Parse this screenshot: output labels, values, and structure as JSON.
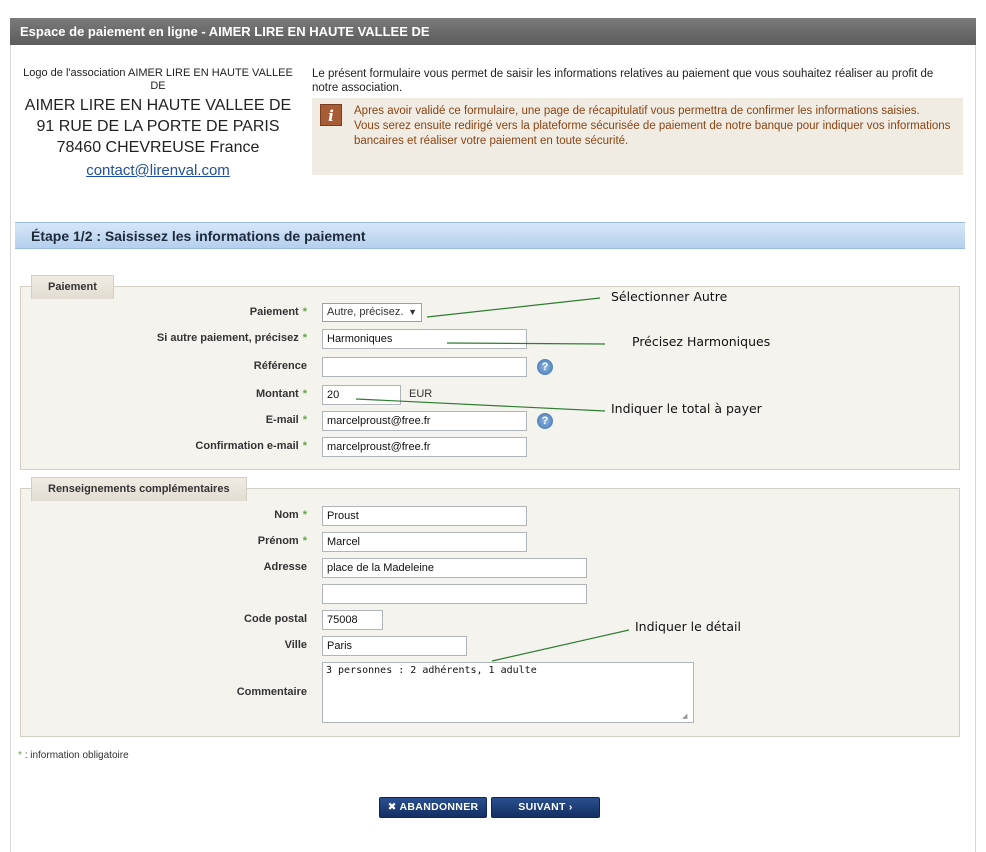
{
  "header": {
    "title": "Espace de paiement en ligne - AIMER LIRE EN HAUTE VALLEE DE"
  },
  "association": {
    "logo_alt": "Logo de l'association AIMER LIRE EN HAUTE VALLEE DE",
    "name": "AIMER LIRE EN HAUTE VALLEE DE",
    "address": "91 RUE DE LA PORTE DE PARIS",
    "city": "78460 CHEVREUSE France",
    "email": "contact@lirenval.com"
  },
  "intro": {
    "text": "Le présent formulaire vous permet de saisir les informations relatives au paiement que vous souhaitez réaliser au profit de notre association.",
    "info_line1": "Apres avoir validé ce formulaire, une page de récapitulatif vous permettra de confirmer les informations saisies.",
    "info_line2": "Vous serez ensuite redirigé vers la plateforme sécurisée de paiement de notre banque pour indiquer vos informations bancaires et réaliser votre paiement en toute sécurité."
  },
  "step": {
    "title": "Étape 1/2 : Saisissez les informations de paiement"
  },
  "payment_section": {
    "legend": "Paiement",
    "paiement_label": "Paiement",
    "paiement_value": "Autre, précisez.",
    "autre_label": "Si autre paiement, précisez",
    "autre_value": "Harmoniques",
    "reference_label": "Référence",
    "reference_value": "",
    "montant_label": "Montant",
    "montant_value": "20",
    "montant_unit": "EUR",
    "email_label": "E-mail",
    "email_value": "marcelproust@free.fr",
    "email_confirm_label": "Confirmation e-mail",
    "email_confirm_value": "marcelproust@free.fr"
  },
  "extra_section": {
    "legend": "Renseignements complémentaires",
    "nom_label": "Nom",
    "nom_value": "Proust",
    "prenom_label": "Prénom",
    "prenom_value": "Marcel",
    "adresse_label": "Adresse",
    "adresse_value": "place de la Madeleine",
    "adresse2_value": "",
    "cp_label": "Code postal",
    "cp_value": "75008",
    "ville_label": "Ville",
    "ville_value": "Paris",
    "commentaire_label": "Commentaire",
    "commentaire_value": "3 personnes : 2 adhérents, 1 adulte"
  },
  "required_marker": "*",
  "mandatory_note": ": information obligatoire",
  "buttons": {
    "cancel": "ABANDONNER",
    "next": "SUIVANT"
  },
  "annotations": {
    "select_autre": "Sélectionner Autre",
    "precisez": "Précisez Harmoniques",
    "total": "Indiquer le total à payer",
    "detail": "Indiquer le détail"
  },
  "colors": {
    "title_bar": "#666666",
    "step_header": "#c5dbf2",
    "button": "#1d3b74",
    "required": "#5fa843",
    "info_text": "#8b4513"
  }
}
